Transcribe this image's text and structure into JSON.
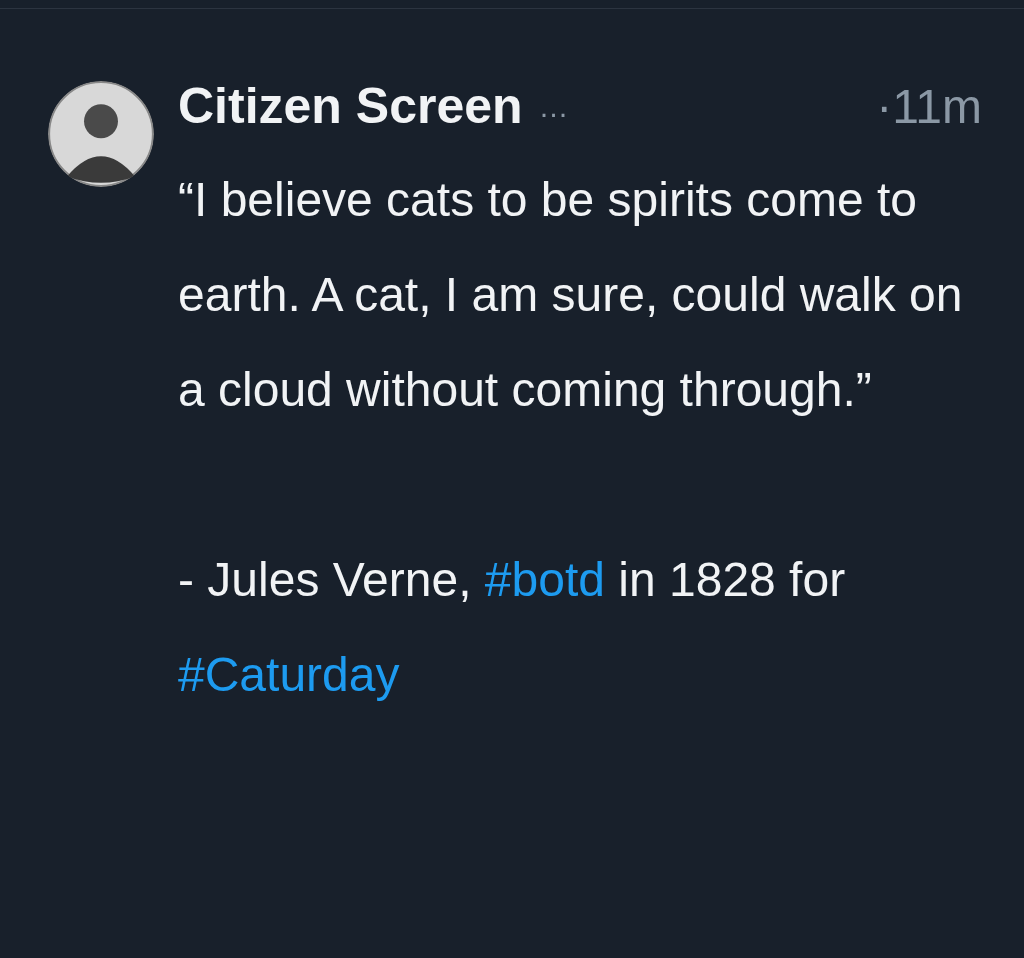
{
  "post": {
    "author": "Citizen Screen",
    "author_ellipsis": "…",
    "time": "·11m",
    "quote": "“I believe cats to be spirits come to earth. A cat, I am sure, could walk on a cloud without coming through.”",
    "attribution": [
      {
        "kind": "text",
        "text": "- Jules Verne, "
      },
      {
        "kind": "hashtag",
        "text": "#botd"
      },
      {
        "kind": "text",
        "text": " in 1828 for "
      },
      {
        "kind": "hashtag",
        "text": "#Caturday"
      }
    ]
  }
}
